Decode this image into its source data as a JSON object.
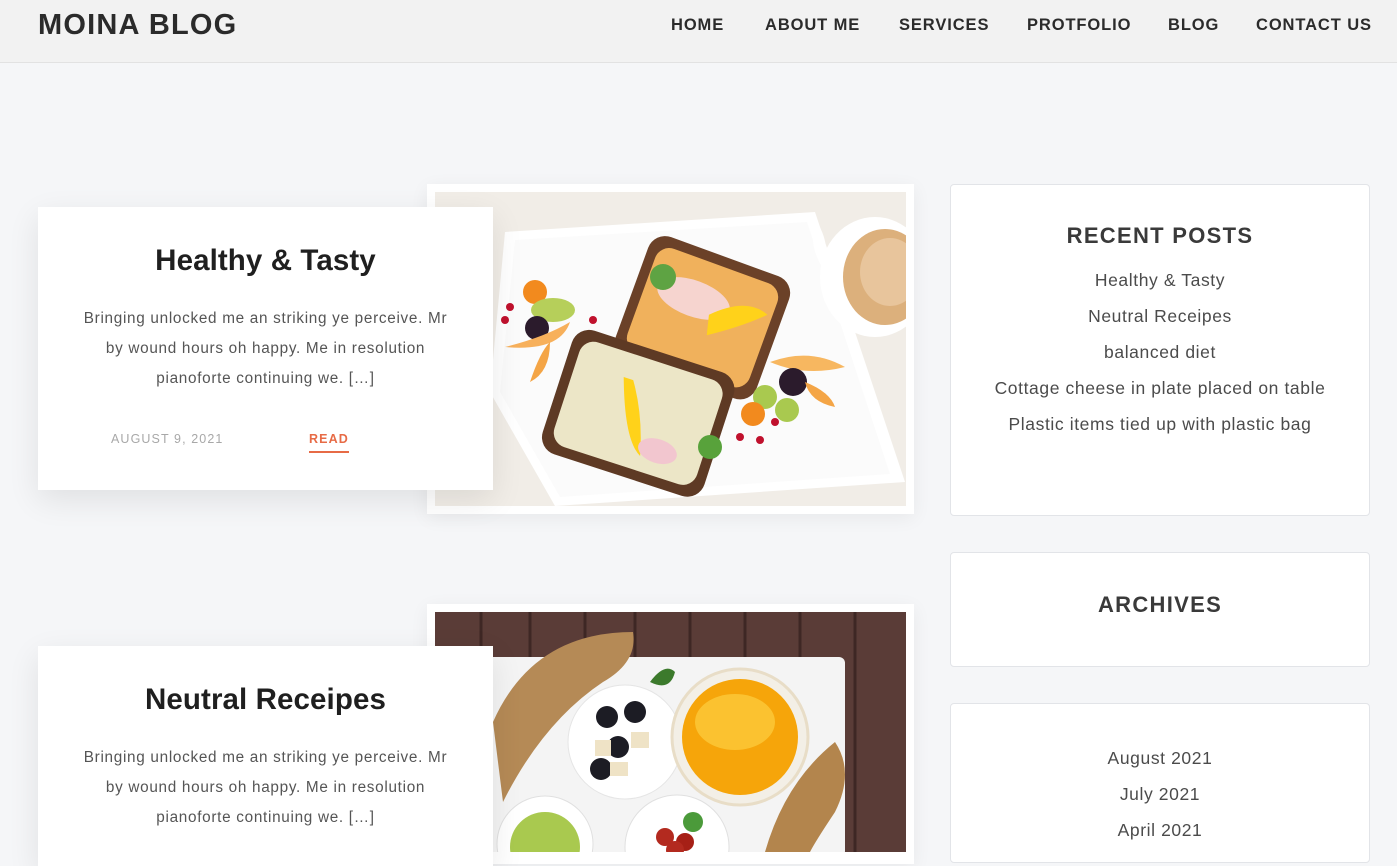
{
  "header": {
    "brand": "MOINA BLOG",
    "nav": [
      "HOME",
      "ABOUT ME",
      "SERVICES",
      "PROTFOLIO",
      "BLOG",
      "CONTACT US"
    ]
  },
  "posts": [
    {
      "title": "Healthy & Tasty",
      "excerpt": "Bringing unlocked me an striking ye perceive. Mr by wound hours oh happy. Me in resolution pianoforte continuing we. […]",
      "date": "AUGUST 9, 2021",
      "read_label": "READ"
    },
    {
      "title": "Neutral Receipes",
      "excerpt": "Bringing unlocked me an striking ye perceive. Mr by wound hours oh happy. Me in resolution pianoforte continuing we. […]"
    }
  ],
  "sidebar": {
    "recent_posts": {
      "title": "RECENT POSTS",
      "items": [
        "Healthy & Tasty",
        "Neutral Receipes",
        "balanced diet",
        "Cottage cheese in plate placed on table",
        "Plastic items tied up with plastic bag"
      ]
    },
    "archives": {
      "title": "ARCHIVES",
      "items": [
        "August 2021",
        "July 2021",
        "April 2021"
      ]
    }
  },
  "colors": {
    "accent": "#e76b46",
    "background": "#f5f6f8",
    "header_bg": "#f2f2f2"
  }
}
